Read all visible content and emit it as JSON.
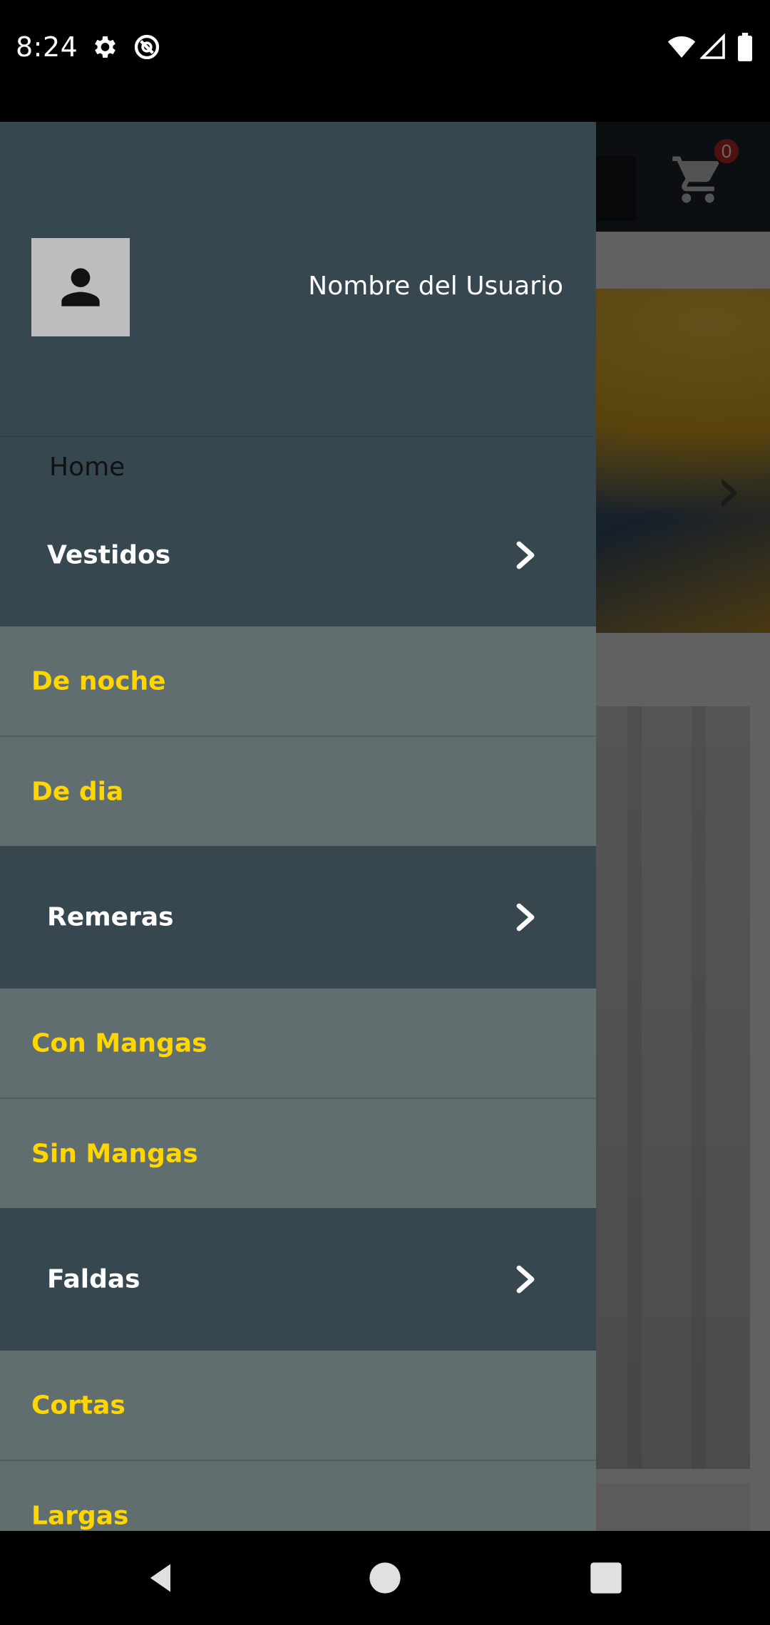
{
  "status_bar": {
    "time": "8:24",
    "left_icons": [
      "settings-icon",
      "do-not-disturb-icon"
    ],
    "right_icons": [
      "wifi-icon",
      "signal-icon",
      "battery-icon"
    ]
  },
  "app": {
    "cart_badge": "0"
  },
  "drawer": {
    "user_name": "Nombre del Usuario",
    "home_label": "Home",
    "sections": [
      {
        "label": "Vestidos",
        "items": [
          "De noche",
          "De dia"
        ]
      },
      {
        "label": "Remeras",
        "items": [
          "Con Mangas",
          "Sin Mangas"
        ]
      },
      {
        "label": "Faldas",
        "items": [
          "Cortas",
          "Largas"
        ]
      }
    ]
  },
  "colors": {
    "drawer_bg": "#37474f",
    "subitem_bg": "#616e70",
    "subitem_text": "#ffd600",
    "badge": "#c62828"
  },
  "nav_bar": {
    "buttons": [
      "back-icon",
      "home-icon",
      "recents-icon"
    ]
  }
}
